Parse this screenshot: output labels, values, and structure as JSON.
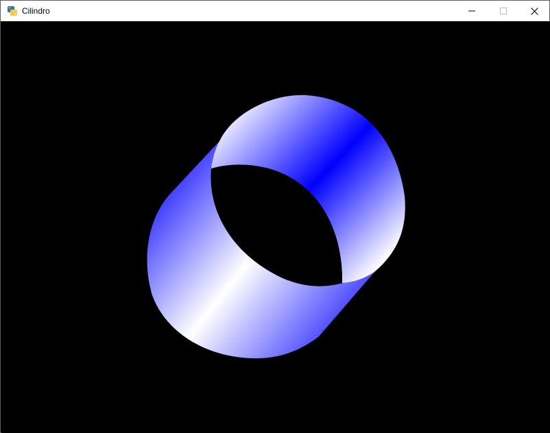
{
  "window": {
    "title": "Cilindro",
    "icons": {
      "app": "python-icon",
      "minimize": "minimize-icon",
      "maximize": "maximize-icon",
      "close": "close-icon"
    }
  },
  "scene": {
    "background": "#000000",
    "object": "cylinder",
    "colors": {
      "primary": "#0000ff",
      "highlight": "#ffffff"
    }
  }
}
